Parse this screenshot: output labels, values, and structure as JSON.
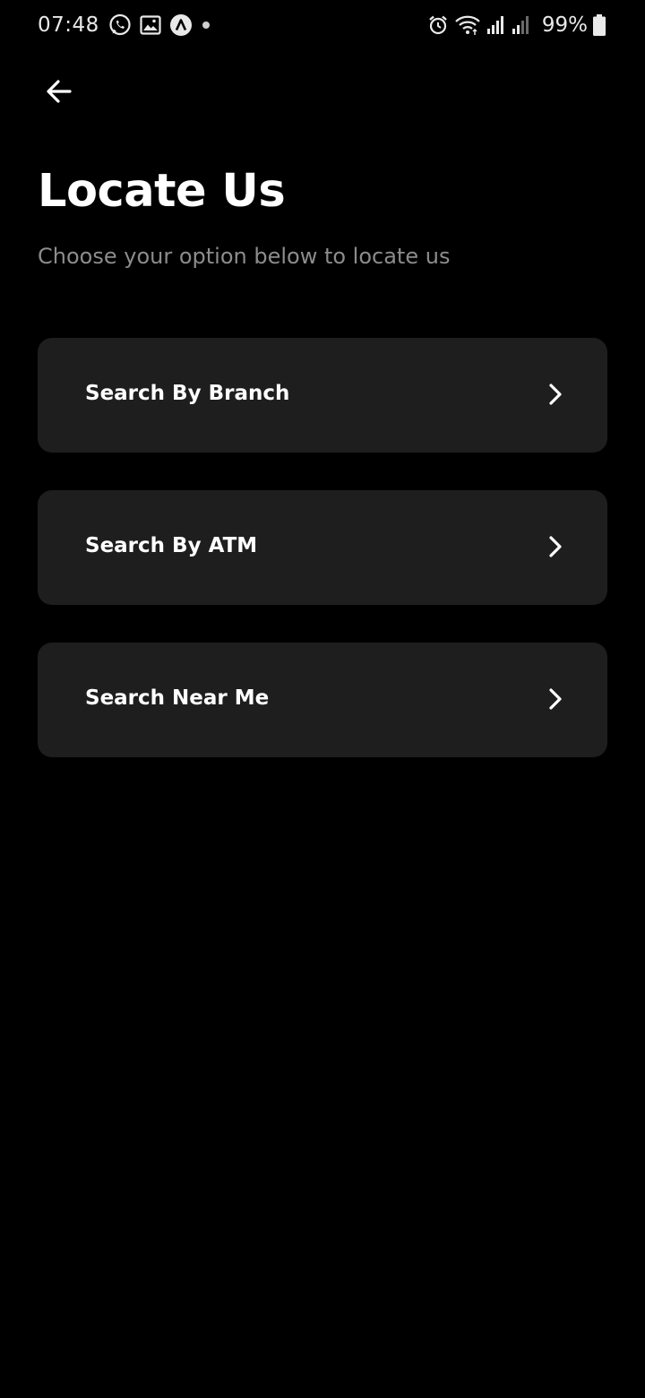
{
  "status_bar": {
    "time": "07:48",
    "battery_percent": "99%",
    "left_icons": [
      "whatsapp-icon",
      "gallery-icon",
      "app-notification-icon",
      "dot-icon"
    ],
    "right_icons": [
      "alarm-icon",
      "wifi-icon",
      "signal-icon",
      "signal-icon",
      "battery-icon"
    ]
  },
  "header": {
    "back_icon": "arrow-left-icon"
  },
  "page": {
    "title": "Locate Us",
    "subtitle": "Choose your option below to locate us"
  },
  "options": [
    {
      "label": "Search By Branch",
      "icon": "chevron-right-icon"
    },
    {
      "label": "Search By ATM",
      "icon": "chevron-right-icon"
    },
    {
      "label": "Search Near Me",
      "icon": "chevron-right-icon"
    }
  ],
  "colors": {
    "background": "#000000",
    "card": "#1e1e1e",
    "title": "#ffffff",
    "subtitle": "#8c8c8c"
  }
}
